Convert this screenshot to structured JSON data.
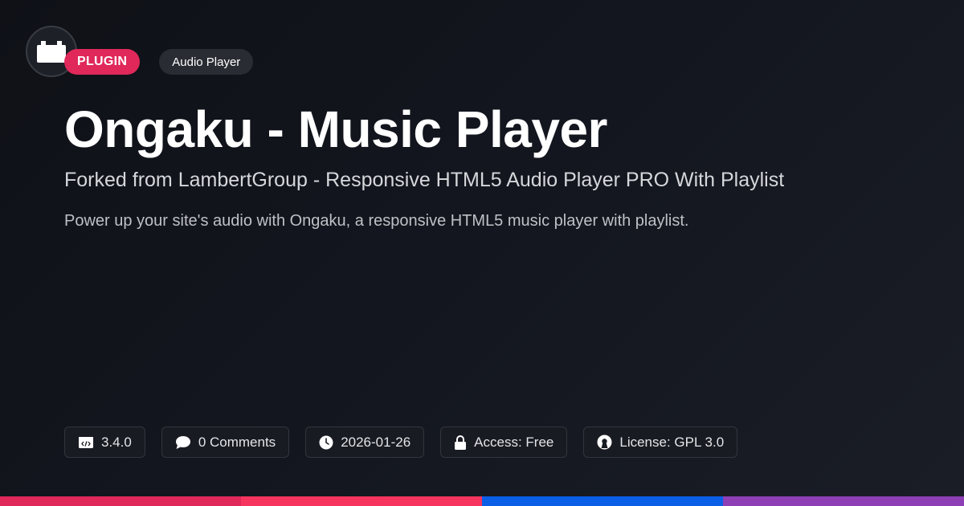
{
  "logo": {
    "icon": "plugin-block-icon"
  },
  "badges": {
    "type": "PLUGIN",
    "category": "Audio Player"
  },
  "title": "Ongaku - Music Player",
  "subtitle": "Forked from LambertGroup - Responsive HTML5 Audio Player PRO With Playlist",
  "description": "Power up your site's audio with Ongaku, a responsive HTML5 music player with playlist.",
  "meta": {
    "version": {
      "icon": "code-window-icon",
      "label": "3.4.0"
    },
    "comments": {
      "icon": "speech-bubble-icon",
      "label": "0 Comments"
    },
    "date": {
      "icon": "clock-icon",
      "label": "2026-01-26"
    },
    "access": {
      "icon": "lock-icon",
      "label": "Access: Free"
    },
    "license": {
      "icon": "open-source-icon",
      "label": "License: GPL 3.0"
    }
  },
  "colors": {
    "accent": "#e0285a",
    "bar": [
      "#e0285a",
      "#f7345e",
      "#0a5fe6",
      "#8e3fb5"
    ]
  }
}
